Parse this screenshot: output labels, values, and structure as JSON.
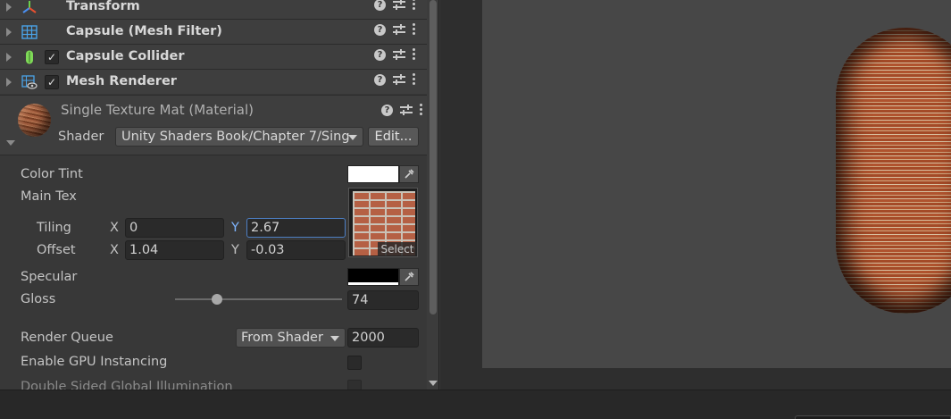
{
  "components": [
    {
      "title": "Transform",
      "icon": "transform-axes-icon",
      "has_checkbox": false
    },
    {
      "title": "Capsule (Mesh Filter)",
      "icon": "mesh-filter-grid-icon",
      "has_checkbox": false
    },
    {
      "title": "Capsule Collider",
      "icon": "capsule-collider-icon",
      "has_checkbox": true
    },
    {
      "title": "Mesh Renderer",
      "icon": "mesh-renderer-icon",
      "has_checkbox": true
    }
  ],
  "material": {
    "title": "Single Texture Mat (Material)",
    "shader_label": "Shader",
    "shader_value": "Unity Shaders Book/Chapter 7/Sing",
    "edit_label": "Edit..."
  },
  "properties": {
    "color_tint_label": "Color Tint",
    "color_tint_value": "#ffffff",
    "main_tex_label": "Main Tex",
    "tiling_label": "Tiling",
    "offset_label": "Offset",
    "x_axis": "X",
    "y_axis": "Y",
    "tiling_x": "0",
    "tiling_y": "2.67",
    "offset_x": "1.04",
    "offset_y": "-0.03",
    "select_label": "Select",
    "specular_label": "Specular",
    "specular_value": "#000000",
    "gloss_label": "Gloss",
    "gloss_value": "74",
    "gloss_slider_fraction": 0.25,
    "render_queue_label": "Render Queue",
    "render_queue_mode": "From Shader",
    "render_queue_value": "2000",
    "gpu_instancing_label": "Enable GPU Instancing",
    "double_sided_gi_label": "Double Sided Global Illumination"
  },
  "icons": {
    "help": "?",
    "check": "✓"
  }
}
